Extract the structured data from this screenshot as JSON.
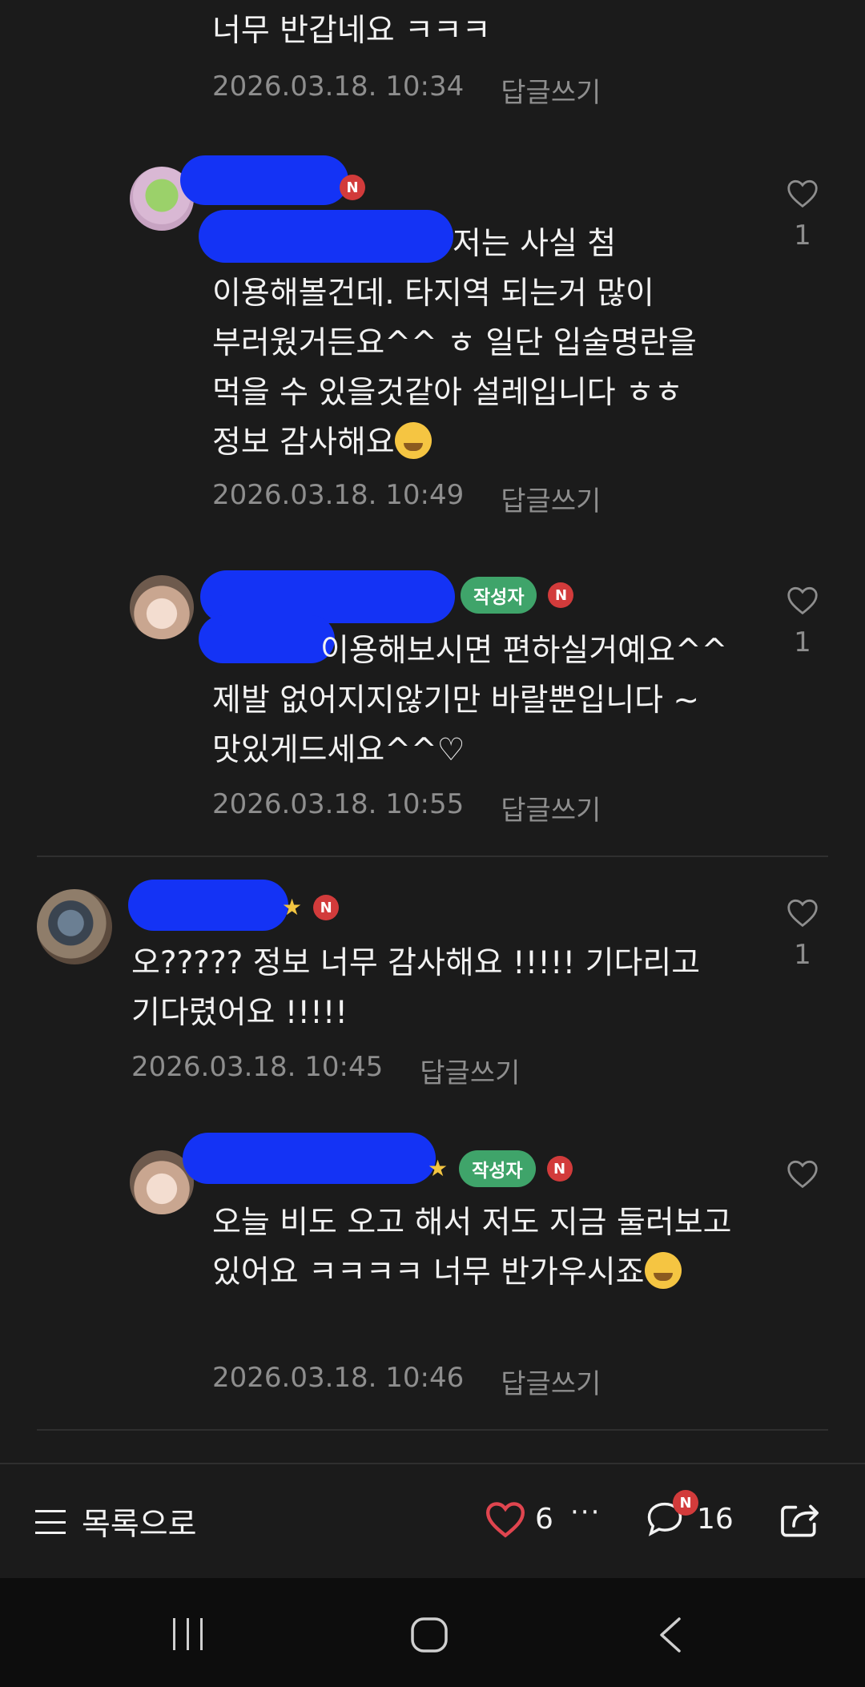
{
  "comments": [
    {
      "indent": true,
      "text": "너무 반갑네요 ㅋㅋㅋ",
      "timestamp": "2026.03.18. 10:34",
      "reply_label": "답글쓰기"
    },
    {
      "indent": true,
      "badge_n": "N",
      "text": "저는 사실 첨 이용해볼건데. 타지역 되는거 많이 부러웠거든요^^ ㅎ 일단 입술명란을 먹을 수 있을것같아 설레입니다 ㅎㅎ 정보 감사해요",
      "timestamp": "2026.03.18. 10:49",
      "reply_label": "답글쓰기",
      "likes": "1"
    },
    {
      "indent": true,
      "author_badge": "작성자",
      "badge_n": "N",
      "text": "이용해보시면 편하실거예요^^ 제발 없어지지않기만 바랄뿐입니다 ~ 맛있게드세요^^♡",
      "timestamp": "2026.03.18. 10:55",
      "reply_label": "답글쓰기",
      "likes": "1"
    },
    {
      "indent": false,
      "badge_n": "N",
      "text": "오????? 정보 너무 감사해요 !!!!! 기다리고 기다렸어요 !!!!!",
      "timestamp": "2026.03.18. 10:45",
      "reply_label": "답글쓰기",
      "likes": "1"
    },
    {
      "indent": true,
      "author_badge": "작성자",
      "badge_n": "N",
      "text": "오늘 비도 오고 해서 저도 지금 둘러보고 있어요 ㅋㅋㅋㅋ 너무 반가우시죠",
      "timestamp": "2026.03.18. 10:46",
      "reply_label": "답글쓰기"
    }
  ],
  "toolbar": {
    "list_label": "목록으로",
    "like_count": "6",
    "more_label": "···",
    "comment_badge": "N",
    "comment_count": "16"
  },
  "icons": {
    "like": "heart-icon",
    "comment": "speech-bubble-icon",
    "share": "share-icon",
    "menu": "hamburger-icon"
  },
  "colors": {
    "background": "#1b1b1b",
    "author_badge": "#3fa46a",
    "new_badge": "#d23b3b",
    "like_heart": "#e0454f"
  }
}
